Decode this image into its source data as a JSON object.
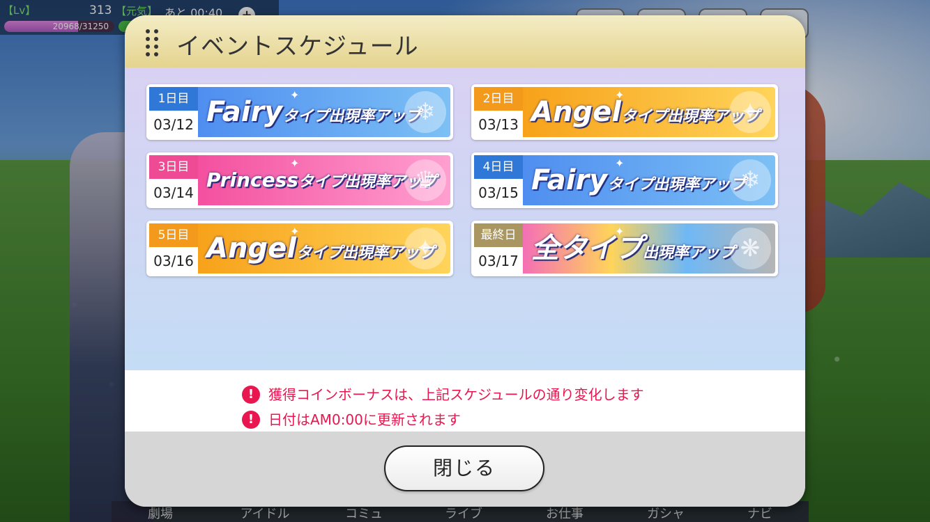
{
  "status": {
    "lv_label": "【Lv】",
    "lv_value": "313",
    "genki_label": "【元気】",
    "timer_label": "あと 00:40",
    "exp_text": "20968/31250",
    "exp_fraction": 0.671
  },
  "bottom_nav": {
    "items": [
      "劇場",
      "アイドル",
      "コミュ",
      "ライブ",
      "お仕事",
      "ガシャ",
      "ナビ"
    ]
  },
  "modal": {
    "title": "イベントスケジュール",
    "schedule": [
      {
        "day": "1日目",
        "date": "03/12",
        "type_word": "Fairy",
        "suffix": "タイプ出現率アップ",
        "kind": "fairy"
      },
      {
        "day": "2日目",
        "date": "03/13",
        "type_word": "Angel",
        "suffix": "タイプ出現率アップ",
        "kind": "angel"
      },
      {
        "day": "3日目",
        "date": "03/14",
        "type_word": "Princess",
        "suffix": "タイプ出現率アップ",
        "kind": "princess"
      },
      {
        "day": "4日目",
        "date": "03/15",
        "type_word": "Fairy",
        "suffix": "タイプ出現率アップ",
        "kind": "fairy"
      },
      {
        "day": "5日目",
        "date": "03/16",
        "type_word": "Angel",
        "suffix": "タイプ出現率アップ",
        "kind": "angel"
      },
      {
        "day": "最終日",
        "date": "03/17",
        "type_word": "全タイプ",
        "suffix": "出現率アップ",
        "kind": "all"
      }
    ],
    "notices": [
      "獲得コインボーナスは、上記スケジュールの通り変化します",
      "日付はAM0:00に更新されます"
    ],
    "notice_icon": "!",
    "close_label": "閉じる"
  }
}
